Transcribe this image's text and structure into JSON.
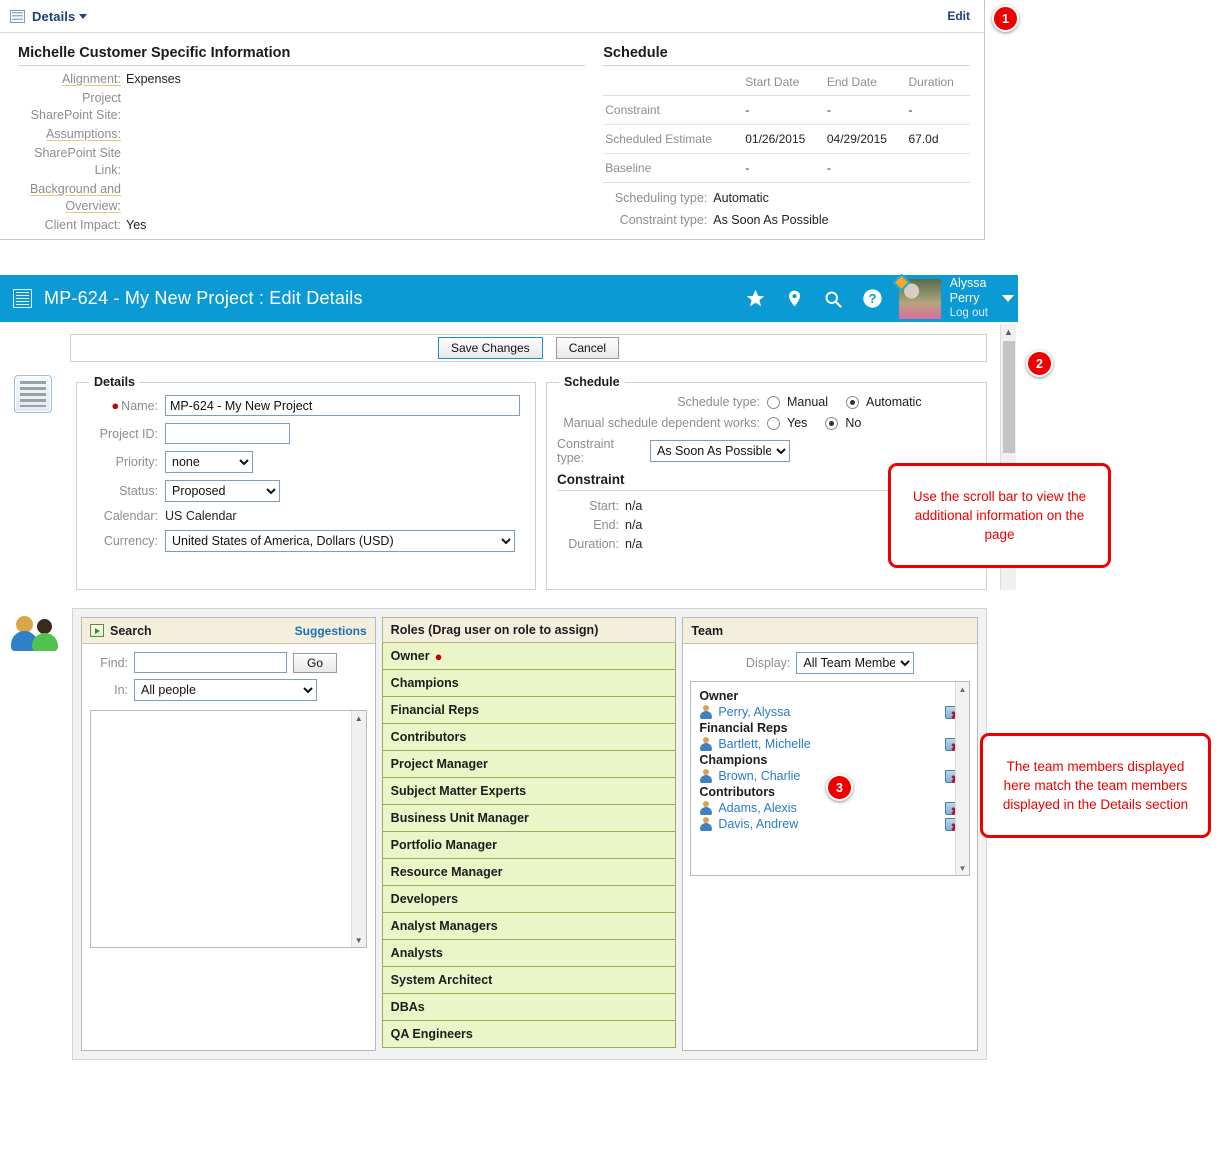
{
  "top_panel": {
    "menu_label": "Details",
    "menu_icon": "grid-icon",
    "edit_link": "Edit",
    "customer_info": {
      "title": "Michelle Customer Specific Information",
      "fields": [
        {
          "label": "Alignment:",
          "value": "Expenses",
          "underlined": true
        },
        {
          "label": "Project SharePoint Site:",
          "value": "",
          "underlined": false
        },
        {
          "label": "Assumptions:",
          "value": "",
          "underlined": true
        },
        {
          "label": "SharePoint Site Link:",
          "value": "",
          "underlined": false
        },
        {
          "label": "Background and Overview:",
          "value": "",
          "underlined": true
        },
        {
          "label": "Client Impact:",
          "value": "Yes",
          "underlined": false
        }
      ]
    },
    "schedule": {
      "title": "Schedule",
      "columns": [
        "",
        "Start Date",
        "End Date",
        "Duration"
      ],
      "rows": [
        {
          "label": "Constraint",
          "start": "-",
          "end": "-",
          "duration": "-"
        },
        {
          "label": "Scheduled Estimate",
          "start": "01/26/2015",
          "end": "04/29/2015",
          "duration": "67.0d"
        },
        {
          "label": "Baseline",
          "start": "-",
          "end": "-",
          "duration": ""
        }
      ],
      "footer": [
        {
          "label": "Scheduling type:",
          "value": "Automatic"
        },
        {
          "label": "Constraint type:",
          "value": "As Soon As Possible"
        }
      ]
    }
  },
  "app_header": {
    "title": "MP-624 - My New Project : Edit Details",
    "logo_icon": "app-logo-icon",
    "icons": [
      "star-icon",
      "location-pin-icon",
      "search-icon",
      "help-icon"
    ],
    "user": {
      "name_line1": "Alyssa",
      "name_line2": "Perry",
      "logout": "Log out"
    },
    "background_color": "#0c9ad4"
  },
  "form": {
    "buttons": {
      "save": "Save Changes",
      "cancel": "Cancel"
    },
    "sidebar_icon": "document-form-icon",
    "details": {
      "legend": "Details",
      "name_label": "Name:",
      "name_value": "MP-624 - My New Project",
      "project_id_label": "Project ID:",
      "project_id_value": "",
      "priority_label": "Priority:",
      "priority_value": "none",
      "status_label": "Status:",
      "status_value": "Proposed",
      "calendar_label": "Calendar:",
      "calendar_value": "US Calendar",
      "currency_label": "Currency:",
      "currency_value": "United States of America, Dollars (USD)"
    },
    "schedule": {
      "legend": "Schedule",
      "schedule_type_label": "Schedule type:",
      "schedule_type_manual": "Manual",
      "schedule_type_automatic": "Automatic",
      "schedule_type_selected": "Automatic",
      "dependent_label": "Manual schedule dependent works:",
      "dependent_yes": "Yes",
      "dependent_no": "No",
      "dependent_selected": "No",
      "constraint_type_label": "Constraint type:",
      "constraint_type_value": "As Soon As Possible",
      "constraint_heading": "Constraint",
      "constraint_rows": [
        {
          "label": "Start:",
          "value": "n/a"
        },
        {
          "label": "End:",
          "value": "n/a"
        },
        {
          "label": "Duration:",
          "value": "n/a"
        }
      ]
    }
  },
  "team_panel": {
    "sidebar_icon": "people-icon",
    "search": {
      "header": "Search",
      "header_icon": "search-panel-icon",
      "suggestions_link": "Suggestions",
      "find_label": "Find:",
      "find_value": "",
      "go_button": "Go",
      "in_label": "In:",
      "in_value": "All people"
    },
    "roles": {
      "header": "Roles (Drag user on role to assign)",
      "items": [
        {
          "label": "Owner",
          "required": true
        },
        {
          "label": "Champions",
          "required": false
        },
        {
          "label": "Financial Reps",
          "required": false
        },
        {
          "label": "Contributors",
          "required": false
        },
        {
          "label": "Project Manager",
          "required": false
        },
        {
          "label": "Subject Matter Experts",
          "required": false
        },
        {
          "label": "Business Unit Manager",
          "required": false
        },
        {
          "label": "Portfolio Manager",
          "required": false
        },
        {
          "label": "Resource Manager",
          "required": false
        },
        {
          "label": "Developers",
          "required": false
        },
        {
          "label": "Analyst Managers",
          "required": false
        },
        {
          "label": "Analysts",
          "required": false
        },
        {
          "label": "System Architect",
          "required": false
        },
        {
          "label": "DBAs",
          "required": false
        },
        {
          "label": "QA Engineers",
          "required": false
        }
      ]
    },
    "team": {
      "header": "Team",
      "display_label": "Display:",
      "display_value": "All Team Members",
      "groups": [
        {
          "role": "Owner",
          "members": [
            "Perry, Alyssa"
          ]
        },
        {
          "role": "Financial Reps",
          "members": [
            "Bartlett, Michelle"
          ]
        },
        {
          "role": "Champions",
          "members": [
            "Brown, Charlie"
          ]
        },
        {
          "role": "Contributors",
          "members": [
            "Adams, Alexis",
            "Davis, Andrew"
          ]
        }
      ],
      "delete_icon": "delete-member-icon"
    }
  },
  "annotations": {
    "badges": [
      {
        "id": "1",
        "text": "1"
      },
      {
        "id": "2",
        "text": "2"
      },
      {
        "id": "3",
        "text": "3"
      }
    ],
    "callouts": [
      {
        "id": "scroll",
        "text": "Use the scroll bar to view the additional information on the page"
      },
      {
        "id": "team",
        "text": "The team members displayed here match the team members displayed in the Details section"
      }
    ],
    "color": "#ee0000"
  }
}
